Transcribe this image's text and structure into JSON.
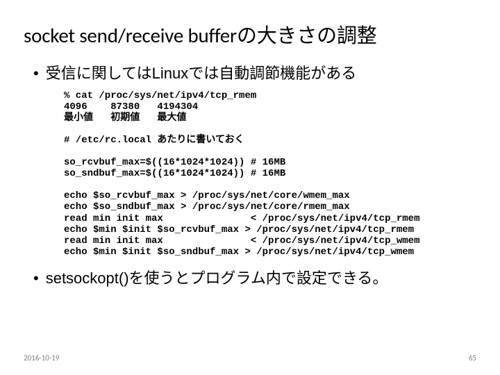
{
  "title": "socket send/receive bufferの大きさの調整",
  "bullets": [
    "受信に関してはLinuxでは自動調節機能がある",
    "setsockopt()を使うとプログラム内で設定できる。"
  ],
  "code": {
    "line1": "% cat /proc/sys/net/ipv4/tcp_rmem",
    "line2": "4096    87380   4194304",
    "line3": "最小値   初期値   最大値",
    "line4": "",
    "line5": "# /etc/rc.local あたりに書いておく",
    "line6": "",
    "line7": "so_rcvbuf_max=$((16*1024*1024)) # 16MB",
    "line8": "so_sndbuf_max=$((16*1024*1024)) # 16MB",
    "line9": "",
    "line10": "echo $so_rcvbuf_max > /proc/sys/net/core/wmem_max",
    "line11": "echo $so_sndbuf_max > /proc/sys/net/core/rmem_max",
    "line12": "read min init max               < /proc/sys/net/ipv4/tcp_rmem",
    "line13": "echo $min $init $so_rcvbuf_max > /proc/sys/net/ipv4/tcp_rmem",
    "line14": "read min init max               < /proc/sys/net/ipv4/tcp_wmem",
    "line15": "echo $min $init $so_sndbuf_max > /proc/sys/net/ipv4/tcp_wmem"
  },
  "footer": {
    "date": "2016-10-19",
    "pagenum": "65"
  }
}
